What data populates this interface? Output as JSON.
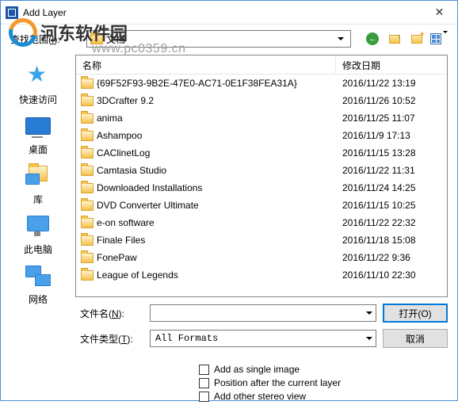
{
  "window": {
    "title": "Add Layer"
  },
  "watermark": {
    "text": "河东软件园",
    "url": "www.pc0359.cn"
  },
  "toolbar": {
    "lookin_label_pre": "查找范围(",
    "lookin_label_key": "I",
    "lookin_label_post": "):",
    "lookin_value": "文档"
  },
  "places": {
    "quick": "快速访问",
    "desktop": "桌面",
    "library": "库",
    "thispc": "此电脑",
    "network": "网络"
  },
  "list": {
    "header_name": "名称",
    "header_date": "修改日期",
    "rows": [
      {
        "name": "{69F52F93-9B2E-47E0-AC71-0E1F38FEA31A}",
        "date": "2016/11/22 13:19"
      },
      {
        "name": "3DCrafter 9.2",
        "date": "2016/11/26 10:52"
      },
      {
        "name": "anima",
        "date": "2016/11/25 11:07"
      },
      {
        "name": "Ashampoo",
        "date": "2016/11/9 17:13"
      },
      {
        "name": "CAClinetLog",
        "date": "2016/11/15 13:28"
      },
      {
        "name": "Camtasia Studio",
        "date": "2016/11/22 11:31"
      },
      {
        "name": "Downloaded Installations",
        "date": "2016/11/24 14:25"
      },
      {
        "name": "DVD Converter Ultimate",
        "date": "2016/11/15 10:25"
      },
      {
        "name": "e-on software",
        "date": "2016/11/22 22:32"
      },
      {
        "name": "Finale Files",
        "date": "2016/11/18 15:08"
      },
      {
        "name": "FonePaw",
        "date": "2016/11/22 9:36"
      },
      {
        "name": "League of Legends",
        "date": "2016/11/10 22:30"
      }
    ]
  },
  "filename": {
    "label_pre": "文件名(",
    "label_key": "N",
    "label_post": "):",
    "value": ""
  },
  "filetype": {
    "label_pre": "文件类型(",
    "label_key": "T",
    "label_post": "):",
    "value": "All Formats"
  },
  "buttons": {
    "open": "打开(O)",
    "cancel": "取消"
  },
  "checks": {
    "single": "Add as single image",
    "position": "Position after the current layer",
    "stereo": "Add other stereo view"
  }
}
